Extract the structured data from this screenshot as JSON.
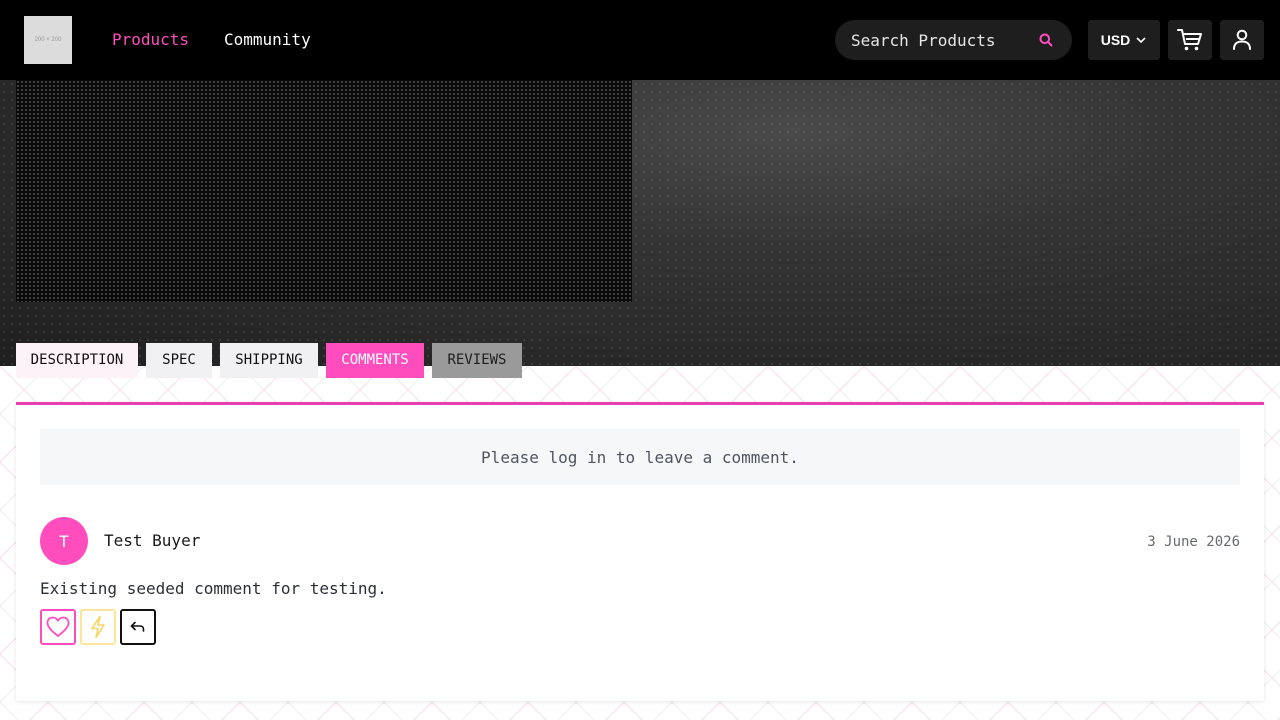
{
  "header": {
    "logo_text": "200 × 200",
    "nav": [
      {
        "label": "Products",
        "active": true
      },
      {
        "label": "Community",
        "active": false
      }
    ],
    "search": {
      "placeholder": "Search Products",
      "icon": "search-icon"
    },
    "currency": {
      "selected": "USD",
      "icon": "chevron-down-icon"
    },
    "cart_icon": "cart-icon",
    "user_icon": "user-icon"
  },
  "tabs": [
    {
      "label": "DESCRIPTION",
      "active": false
    },
    {
      "label": "SPEC",
      "active": false
    },
    {
      "label": "SHIPPING",
      "active": false
    },
    {
      "label": "COMMENTS",
      "active": true
    },
    {
      "label": "REVIEWS",
      "active": false
    }
  ],
  "comments": {
    "login_prompt": "Please log in to leave a comment.",
    "items": [
      {
        "avatar_initial": "T",
        "author": "Test Buyer",
        "date": "3 June 2026",
        "text": "Existing seeded comment for testing.",
        "actions": [
          "heart-icon",
          "lightning-icon",
          "reply-icon"
        ]
      }
    ]
  },
  "colors": {
    "accent": "#ff4dbe",
    "header_bg": "#000000",
    "flash_border": "#fbe59a"
  }
}
